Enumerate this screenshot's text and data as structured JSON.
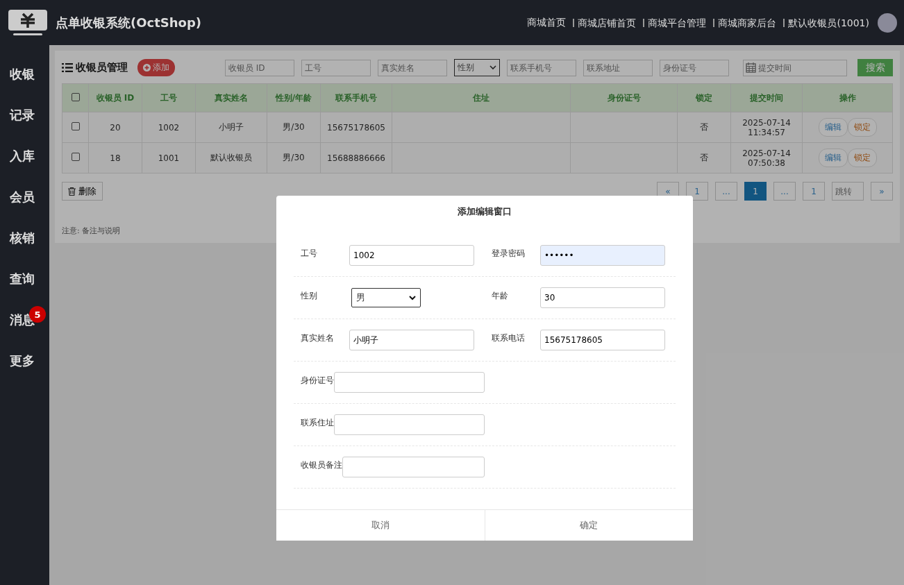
{
  "header": {
    "title": "点单收银系统(OctShop)",
    "links": [
      "商城首页",
      "商城店铺首页",
      "商城平台管理",
      "商城商家后台",
      "默认收银员(1001)"
    ]
  },
  "sidebar": {
    "items": [
      {
        "label": "收银"
      },
      {
        "label": "记录"
      },
      {
        "label": "入库"
      },
      {
        "label": "会员"
      },
      {
        "label": "核销"
      },
      {
        "label": "查询"
      },
      {
        "label": "消息",
        "badge": "5"
      },
      {
        "label": "更多"
      }
    ]
  },
  "panel": {
    "title": "收银员管理",
    "add_button": "添加",
    "filters": [
      {
        "kind": "input",
        "placeholder": "收银员 ID"
      },
      {
        "kind": "input",
        "placeholder": "工号"
      },
      {
        "kind": "input",
        "placeholder": "真实姓名"
      },
      {
        "kind": "select",
        "value": "性别"
      },
      {
        "kind": "input",
        "placeholder": "联系手机号"
      },
      {
        "kind": "input",
        "placeholder": "联系地址"
      },
      {
        "kind": "input",
        "placeholder": "身份证号"
      },
      {
        "kind": "date",
        "placeholder": "提交时间"
      }
    ],
    "search_button": "搜索",
    "table": {
      "all_checked": false,
      "columns": [
        "收银员 ID",
        "工号",
        "真实姓名",
        "性别/年龄",
        "联系手机号",
        "住址",
        "身份证号",
        "锁定",
        "提交时间",
        "操作"
      ],
      "rows": [
        {
          "checked": false,
          "cells": [
            "20",
            "1002",
            "小明子",
            "男/30",
            "15675178605",
            "",
            "",
            "否",
            "2025-07-14 11:34:57"
          ],
          "actions": [
            "编辑",
            "锁定"
          ]
        },
        {
          "checked": false,
          "cells": [
            "18",
            "1001",
            "默认收银员",
            "男/30",
            "15688886666",
            "",
            "",
            "否",
            "2025-07-14 07:50:38"
          ],
          "actions": [
            "编辑",
            "锁定"
          ]
        }
      ]
    },
    "delete_button": "删除",
    "pagination": [
      {
        "label": "«",
        "selected": false
      },
      {
        "label": "1",
        "selected": false
      },
      {
        "label": "...",
        "selected": false
      },
      {
        "label": "1",
        "selected": true
      },
      {
        "label": "...",
        "selected": false
      },
      {
        "label": "1",
        "selected": false
      },
      {
        "placeholder": "跳转",
        "kind": "input"
      },
      {
        "label": "»",
        "selected": false
      }
    ],
    "note": "注意: 备注与说明"
  },
  "dialog": {
    "title": "添加编辑窗口",
    "rows": [
      [
        {
          "label": "工号",
          "kind": "input",
          "value": "1002"
        },
        {
          "label": "登录密码",
          "kind": "password",
          "value": "••••••"
        }
      ],
      [
        {
          "label": "性别",
          "kind": "select",
          "value": "男"
        },
        {
          "label": "年龄",
          "kind": "input",
          "value": "30"
        }
      ],
      [
        {
          "label": "真实姓名",
          "kind": "input",
          "value": "小明子"
        },
        {
          "label": "联系电话",
          "kind": "input",
          "value": "15675178605"
        }
      ],
      [
        {
          "label": "身份证号",
          "kind": "wide"
        }
      ],
      [
        {
          "label": "联系住址",
          "kind": "wide"
        }
      ],
      [
        {
          "label": "收银员备注",
          "kind": "wide"
        }
      ]
    ],
    "buttons": [
      "取消",
      "确定"
    ]
  }
}
